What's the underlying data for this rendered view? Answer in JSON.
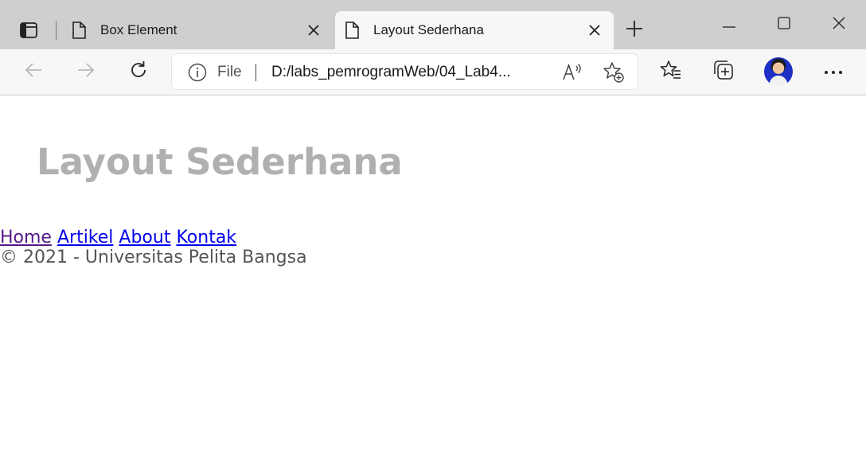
{
  "browser": {
    "tabs": [
      {
        "title": "Box Element",
        "active": false
      },
      {
        "title": "Layout Sederhana",
        "active": true
      }
    ],
    "address": {
      "scheme_label": "File",
      "url": "D:/labs_pemrogramWeb/04_Lab4..."
    },
    "icons": {
      "tab_actions": "tab-actions-icon",
      "page": "page-icon",
      "close": "close-icon",
      "new_tab": "plus-icon",
      "back": "back-arrow-icon",
      "forward": "forward-arrow-icon",
      "refresh": "refresh-icon",
      "info": "info-icon",
      "read_aloud": "read-aloud-icon",
      "add_favorite": "star-plus-icon",
      "favorites": "favorites-icon",
      "collections": "collections-icon",
      "more": "more-icon"
    }
  },
  "page": {
    "heading": "Layout Sederhana",
    "nav": [
      "Home",
      "Artikel",
      "About",
      "Kontak"
    ],
    "footer": "© 2021 - Universitas Pelita Bangsa"
  },
  "colors": {
    "heading": "#b0b0b0",
    "link": "#0000ee",
    "visited_link": "#551a8b",
    "footer_text": "#555555",
    "tabstrip_bg": "#cfcfcf",
    "toolbar_bg": "#f7f7f7",
    "avatar_bg": "#1d2fc4"
  }
}
